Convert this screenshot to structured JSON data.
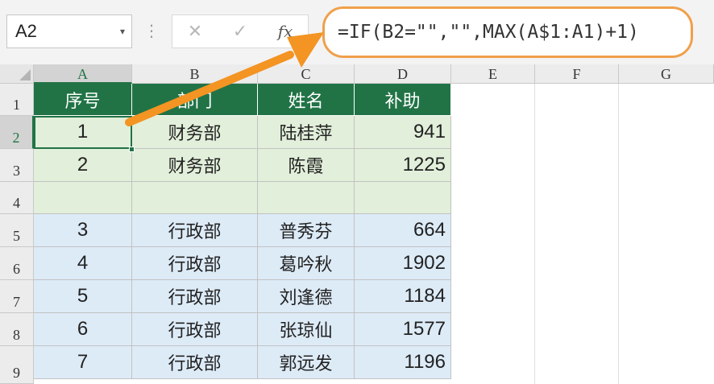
{
  "formula_bar": {
    "name_box": "A2",
    "name_box_dropdown": "▾",
    "separator": "⋮",
    "cancel_icon": "✕",
    "enter_icon": "✓",
    "fx_icon": "fx",
    "formula": "=IF(B2=\"\",\"\",MAX(A$1:A1)+1)"
  },
  "columns": [
    "A",
    "B",
    "C",
    "D",
    "E",
    "F",
    "G"
  ],
  "rows": [
    "1",
    "2",
    "3",
    "4",
    "5",
    "6",
    "7",
    "8",
    "9"
  ],
  "table": {
    "headers": [
      "序号",
      "部门",
      "姓名",
      "补助"
    ],
    "data": [
      [
        "1",
        "财务部",
        "陆桂萍",
        "941"
      ],
      [
        "2",
        "财务部",
        "陈霞",
        "1225"
      ],
      [
        "",
        "",
        "",
        ""
      ],
      [
        "3",
        "行政部",
        "普秀芬",
        "664"
      ],
      [
        "4",
        "行政部",
        "葛吟秋",
        "1902"
      ],
      [
        "5",
        "行政部",
        "刘逢德",
        "1184"
      ],
      [
        "6",
        "行政部",
        "张琼仙",
        "1577"
      ],
      [
        "7",
        "行政部",
        "郭远发",
        "1196"
      ]
    ]
  },
  "colors": {
    "header_green": "#217346",
    "finance_fill": "#e2efda",
    "admin_fill": "#ddebf7",
    "highlight_orange": "#f0a04b",
    "arrow_orange": "#f39423"
  }
}
